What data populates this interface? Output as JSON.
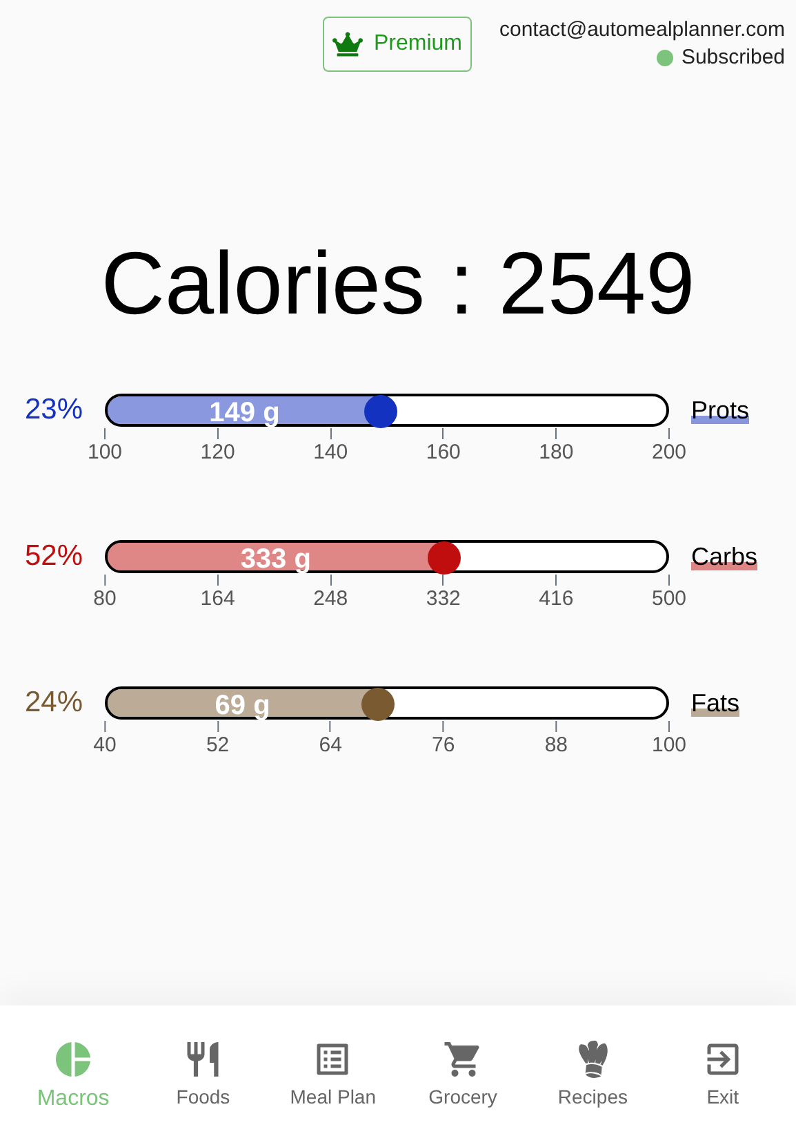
{
  "header": {
    "premium_button": "Premium",
    "email": "contact@automealplanner.com",
    "status": "Subscribed"
  },
  "title": "Calories : 2549",
  "macros": [
    {
      "percent": "23%",
      "value": "149 g",
      "label": "Prots",
      "color": "#1432c0",
      "level": 0.49,
      "ticks": [
        "100",
        "120",
        "140",
        "160",
        "180",
        "200"
      ]
    },
    {
      "percent": "52%",
      "value": "333 g",
      "label": "Carbs",
      "color": "#c00e0e",
      "level": 0.602,
      "ticks": [
        "80",
        "164",
        "248",
        "332",
        "416",
        "500"
      ]
    },
    {
      "percent": "24%",
      "value": "69 g",
      "label": "Fats",
      "color": "#7a5a30",
      "level": 0.483,
      "ticks": [
        "40",
        "52",
        "64",
        "76",
        "88",
        "100"
      ]
    }
  ],
  "nav": [
    {
      "label": "Macros",
      "selected": true
    },
    {
      "label": "Foods",
      "selected": false
    },
    {
      "label": "Meal Plan",
      "selected": false
    },
    {
      "label": "Grocery",
      "selected": false
    },
    {
      "label": "Recipes",
      "selected": false
    },
    {
      "label": "Exit",
      "selected": false
    }
  ]
}
